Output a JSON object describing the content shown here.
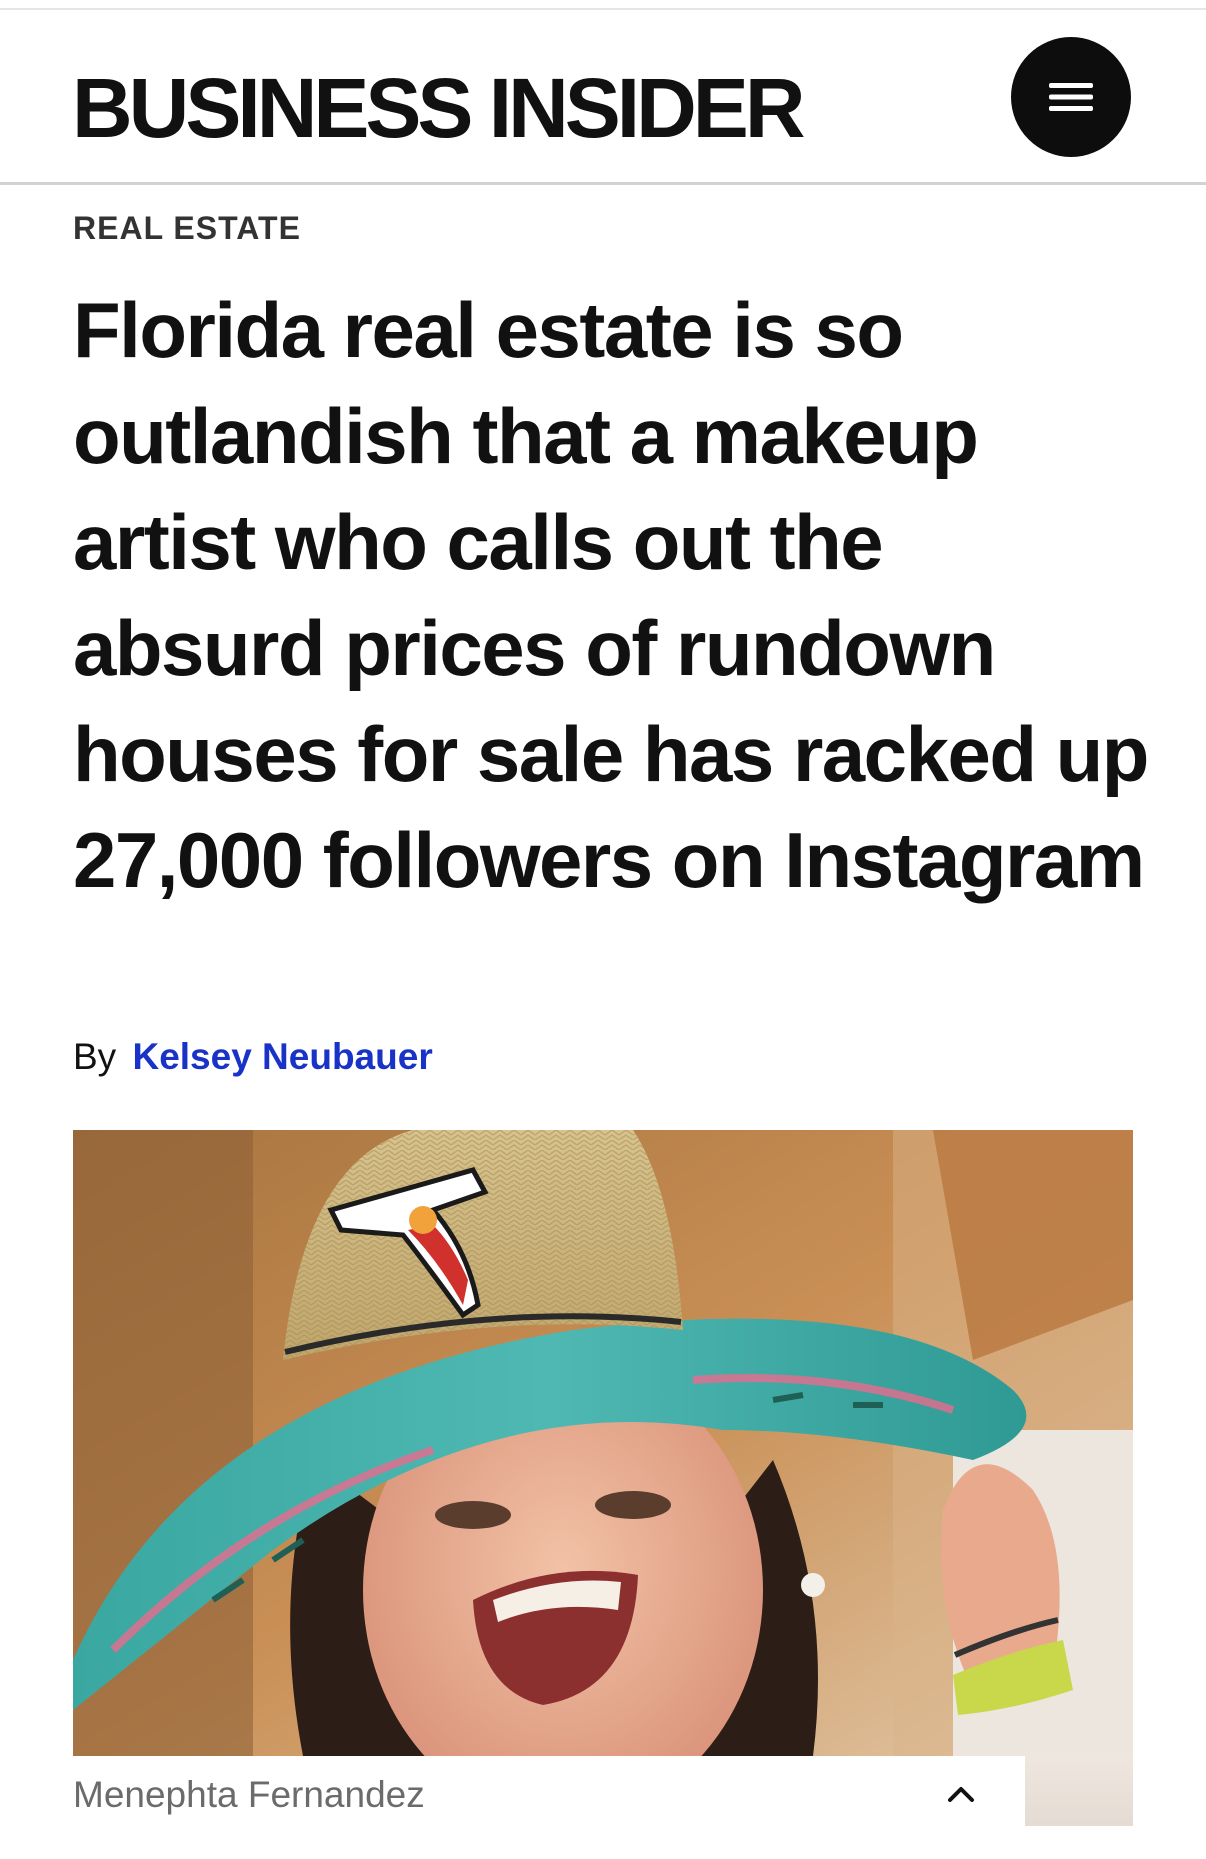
{
  "header": {
    "logo_text": "BUSINESS INSIDER",
    "menu_icon": "hamburger-menu-icon"
  },
  "article": {
    "section": "REAL ESTATE",
    "headline": "Florida real estate is so outlandish that a makeup artist who calls out the absurd prices of rundown houses for sale has racked up 27,000 followers on Instagram",
    "byline_prefix": "By",
    "author": "Kelsey Neubauer"
  },
  "hero_image": {
    "credit": "Menephta Fernandez",
    "caption_toggle_icon": "chevron-up-icon"
  },
  "colors": {
    "author_link": "#1932c8",
    "menu_button": "#0d0d0d",
    "credit_text": "#6b6b6b"
  }
}
